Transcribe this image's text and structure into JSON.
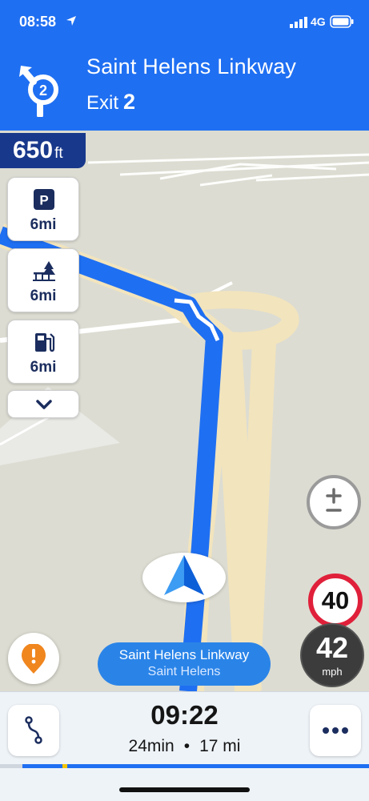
{
  "status_bar": {
    "time": "08:58",
    "network": "4G"
  },
  "instruction": {
    "street": "Saint Helens Linkway",
    "exit_label": "Exit",
    "exit_number": "2",
    "roundabout_exit": "2"
  },
  "distance": {
    "value": "650",
    "unit": "ft"
  },
  "poi": [
    {
      "icon": "parking-icon",
      "distance": "6mi"
    },
    {
      "icon": "picnic-area-icon",
      "distance": "6mi"
    },
    {
      "icon": "fuel-station-icon",
      "distance": "6mi"
    }
  ],
  "speed": {
    "limit": "40",
    "current": "42",
    "unit": "mph"
  },
  "current_street": {
    "name": "Saint Helens Linkway",
    "area": "Saint Helens"
  },
  "trip": {
    "eta": "09:22",
    "duration": "24min",
    "separator": "•",
    "distance": "17 mi",
    "progress": 0.17
  },
  "colors": {
    "header": "#1f6ff2",
    "route": "#1f6ff2",
    "badge": "#18388b",
    "speed_limit_ring": "#e0203a"
  }
}
